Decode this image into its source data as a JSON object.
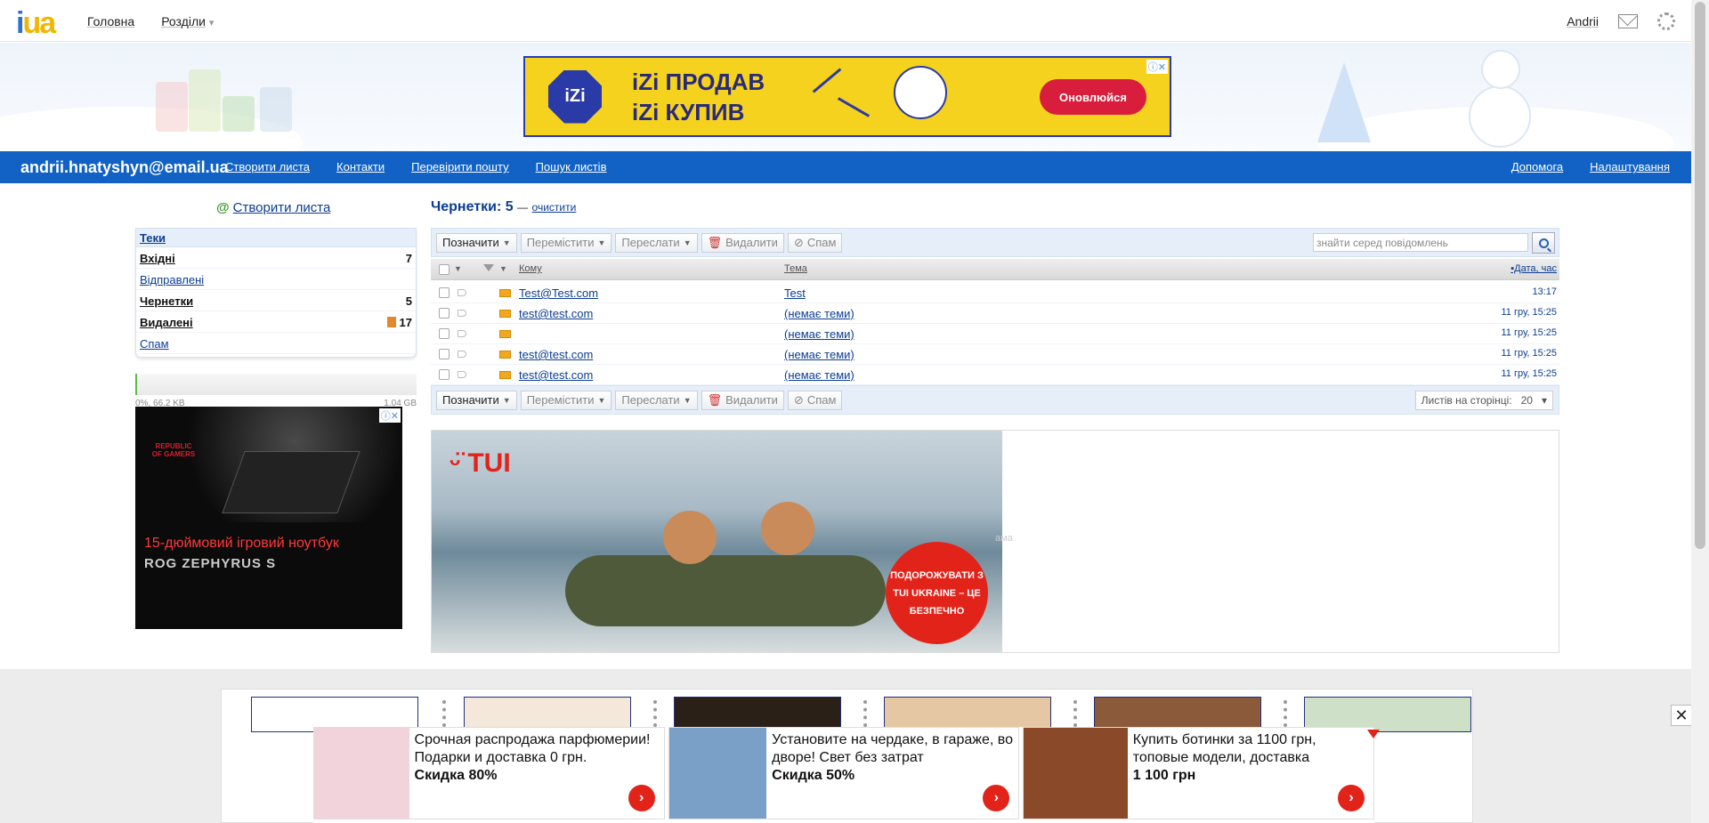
{
  "topbar": {
    "logo_i": "i",
    "logo_ua": "ua",
    "nav_home": "Головна",
    "nav_sections": "Розділи",
    "user": "Andrii"
  },
  "ad_izi": {
    "logo": "iZi",
    "line1": "iZi ПРОДАВ",
    "line2": "iZi КУПИВ",
    "button": "Оновлюйся",
    "close": "ⓘ✕"
  },
  "bluebar": {
    "email": "andrii.hnatyshyn@email.ua",
    "compose": "Створити листа",
    "contacts": "Контакти",
    "check_mail": "Перевірити пошту",
    "search_mail": "Пошук листів",
    "help": "Допомога",
    "settings": "Налаштування"
  },
  "sidebar": {
    "compose": "Створити листа",
    "folders_title": "Теки",
    "folders": [
      {
        "name": "Вхідні",
        "count": "7",
        "bold": true
      },
      {
        "name": "Відправлені",
        "count": "",
        "bold": false
      },
      {
        "name": "Чернетки",
        "count": "5",
        "bold": true
      },
      {
        "name": "Видалені",
        "count": "17",
        "bold": true
      },
      {
        "name": "Спам",
        "count": "",
        "bold": false
      }
    ],
    "quota_used": "0%, 66.2 KB",
    "quota_total": "1.04 GB"
  },
  "ad_rog": {
    "logo": "REPUBLIC OF GAMERS",
    "line1": "15-дюймовий ігровий ноутбук",
    "line2": "ROG ZEPHYRUS S",
    "close": "ⓘ✕"
  },
  "main": {
    "title": "Чернетки: 5",
    "dash": "—",
    "clear": "очистити",
    "toolbar": {
      "mark": "Позначити",
      "move": "Перемістити",
      "forward": "Переслати",
      "delete": "Видалити",
      "spam": "Спам",
      "search_placeholder": "знайти серед повідомлень",
      "per_page_label": "Листів на сторінці:",
      "per_page_value": "20"
    },
    "columns": {
      "to": "Кому",
      "subject": "Тема",
      "date": "▪Дата, час"
    },
    "rows": [
      {
        "to": "Test@Test.com",
        "subject": "Test",
        "date": "13:17"
      },
      {
        "to": "test@test.com",
        "subject": "(немає теми)",
        "date": "11 гру, 15:25"
      },
      {
        "to": "",
        "subject": "(немає теми)",
        "date": "11 гру, 15:25"
      },
      {
        "to": "test@test.com",
        "subject": "(немає теми)",
        "date": "11 гру, 15:25"
      },
      {
        "to": "test@test.com",
        "subject": "(немає теми)",
        "date": "11 гру, 15:25"
      }
    ]
  },
  "ad_tui": {
    "logo": "TUI",
    "badge": "ПОДОРОЖУВАТИ З TUI UKRAINE – ЦЕ БЕЗПЕЧНО",
    "ghost": "ама"
  },
  "bottom_ads": [
    {
      "text": "Срочная распродажа парфюмерии! Подарки и доставка 0 грн.",
      "discount": "Скидка 80%",
      "img_color": "#f2d3dc"
    },
    {
      "text": "Установите на чердаке, в гараже, во дворе! Свет без затрат",
      "discount": "Скидка 50%",
      "img_color": "#7aa0c8"
    },
    {
      "text": "Купить ботинки за 1100 грн, топовые модели, доставка",
      "discount": "1 100 грн",
      "img_color": "#8a4a2a"
    }
  ],
  "close_label": "✕",
  "go_label": "›"
}
